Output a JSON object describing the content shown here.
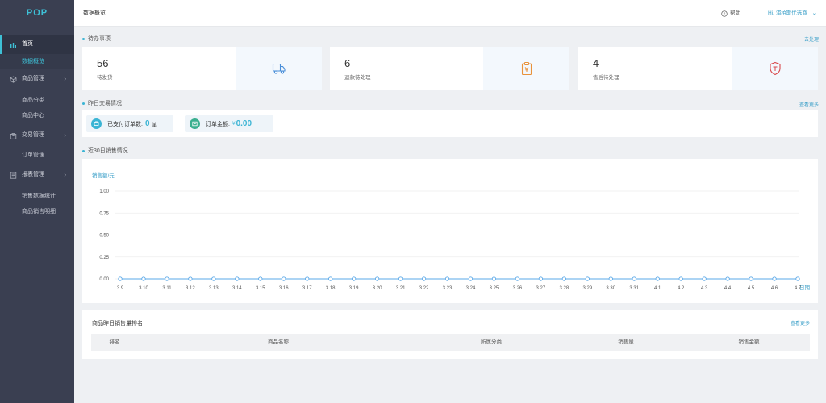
{
  "sidebar": {
    "logo": "POP",
    "items": [
      {
        "label": "首页",
        "icon": "bar-chart-icon",
        "active": true
      },
      {
        "label": "商品管理",
        "icon": "cube-icon"
      },
      {
        "label": "交易管理",
        "icon": "bag-icon"
      },
      {
        "label": "报表管理",
        "icon": "report-icon"
      }
    ],
    "subs": {
      "home": [
        "数据概览"
      ],
      "goods": [
        "商品分类",
        "商品中心"
      ],
      "trade": [
        "订单管理"
      ],
      "report": [
        "销售数据统计",
        "商品销售明细"
      ]
    }
  },
  "header": {
    "title": "数据概览",
    "help": "帮助",
    "user": "Hi, 浦柏斯优选商"
  },
  "todo": {
    "title": "待办事项",
    "link": "去处理",
    "cards": [
      {
        "value": "56",
        "label": "待发货",
        "icon": "truck-icon"
      },
      {
        "value": "6",
        "label": "退款待处理",
        "icon": "refund-clipboard-icon"
      },
      {
        "value": "4",
        "label": "售后待处理",
        "icon": "after-sales-shield-icon"
      }
    ]
  },
  "yesterday": {
    "title": "昨日交易情况",
    "link": "查看更多",
    "paid_orders_label": "已支付订单数:",
    "paid_orders_value": "0",
    "paid_orders_unit": "笔",
    "amount_label": "订单金额:",
    "amount_currency": "¥",
    "amount_value": "0.00"
  },
  "sales30": {
    "title": "近30日销售情况"
  },
  "chart_data": {
    "type": "line",
    "ylabel": "销售额/元",
    "xlabel": "日期",
    "ylim": [
      0,
      1
    ],
    "yticks": [
      "1.00",
      "0.75",
      "0.50",
      "0.25",
      "0.00"
    ],
    "x": [
      "3.9",
      "3.10",
      "3.11",
      "3.12",
      "3.13",
      "3.14",
      "3.15",
      "3.16",
      "3.17",
      "3.18",
      "3.19",
      "3.20",
      "3.21",
      "3.22",
      "3.23",
      "3.24",
      "3.25",
      "3.26",
      "3.27",
      "3.28",
      "3.29",
      "3.30",
      "3.31",
      "4.1",
      "4.2",
      "4.3",
      "4.4",
      "4.5",
      "4.6",
      "4.7"
    ],
    "series": [
      {
        "values": [
          0,
          0,
          0,
          0,
          0,
          0,
          0,
          0,
          0,
          0,
          0,
          0,
          0,
          0,
          0,
          0,
          0,
          0,
          0,
          0,
          0,
          0,
          0,
          0,
          0,
          0,
          0,
          0,
          0,
          0
        ]
      }
    ],
    "grid": true,
    "line_color": "#5aa8e8"
  },
  "ranking": {
    "title": "商品昨日销售量排名",
    "link": "查看更多",
    "columns": [
      "排名",
      "商品名称",
      "所属分类",
      "销售量",
      "销售金额"
    ]
  },
  "colors": {
    "accent": "#3ab4d4",
    "sidebar": "#3a3f51"
  }
}
